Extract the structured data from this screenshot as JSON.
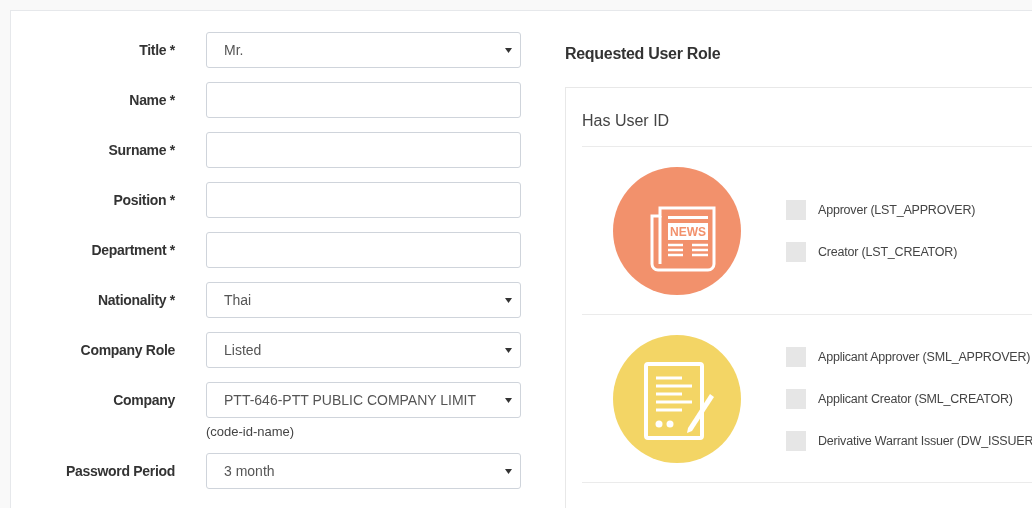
{
  "form": {
    "fields": [
      {
        "label": "Title *",
        "kind": "select",
        "value": "Mr."
      },
      {
        "label": "Name *",
        "kind": "text"
      },
      {
        "label": "Surname *",
        "kind": "text"
      },
      {
        "label": "Position *",
        "kind": "text"
      },
      {
        "label": "Department *",
        "kind": "text"
      },
      {
        "label": "Nationality *",
        "kind": "select",
        "value": "Thai"
      },
      {
        "label": "Company Role",
        "kind": "select",
        "value": "Listed"
      },
      {
        "label": "Company",
        "kind": "select",
        "value": "PTT-646-PTT PUBLIC COMPANY LIMIT",
        "help": "(code-id-name)"
      },
      {
        "label": "Password Period",
        "kind": "select",
        "value": "3 month"
      }
    ]
  },
  "roles": {
    "title": "Requested User Role",
    "panel_title": "Has User ID",
    "groups": [
      {
        "kind": "news",
        "icon_text": "NEWS",
        "color": "#f2916c",
        "options": [
          {
            "label": "Approver (LST_APPROVER)",
            "checked": false
          },
          {
            "label": "Creator (LST_CREATOR)",
            "checked": false
          }
        ]
      },
      {
        "kind": "document",
        "color": "#f3d565",
        "options": [
          {
            "label": "Applicant Approver (SML_APPROVER)",
            "checked": false
          },
          {
            "label": "Applicant Creator (SML_CREATOR)",
            "checked": false
          },
          {
            "label": "Derivative Warrant Issuer (DW_ISSUER",
            "checked": false
          }
        ]
      }
    ]
  }
}
